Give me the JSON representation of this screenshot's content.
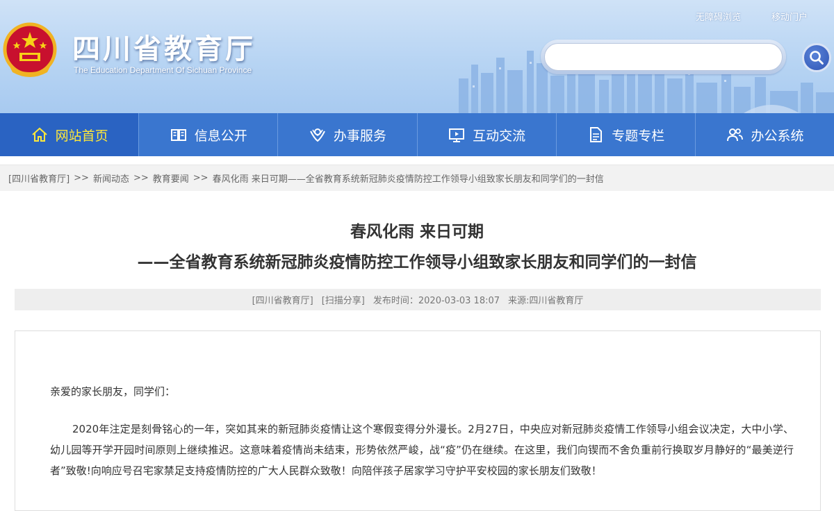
{
  "header": {
    "title": "四川省教育厅",
    "subtitle": "The Education Department Of Sichuan Province",
    "top_links": [
      "无障碍浏览",
      "移动门户"
    ],
    "search": {
      "value": "",
      "placeholder": ""
    }
  },
  "nav": {
    "items": [
      {
        "label": "网站首页",
        "icon": "home-icon",
        "active": true
      },
      {
        "label": "信息公开",
        "icon": "book-icon",
        "active": false
      },
      {
        "label": "办事服务",
        "icon": "service-icon",
        "active": false
      },
      {
        "label": "互动交流",
        "icon": "monitor-icon",
        "active": false
      },
      {
        "label": "专题专栏",
        "icon": "document-icon",
        "active": false
      },
      {
        "label": "办公系统",
        "icon": "users-icon",
        "active": false
      }
    ]
  },
  "breadcrumb": {
    "home": "[四川省教育厅]",
    "sep": ">>",
    "level1": "新闻动态",
    "level2": "教育要闻",
    "current": "春风化雨 来日可期——全省教育系统新冠肺炎疫情防控工作领导小组致家长朋友和同学们的一封信"
  },
  "article": {
    "title_line1": "春风化雨 来日可期",
    "title_line2": "——全省教育系统新冠肺炎疫情防控工作领导小组致家长朋友和同学们的一封信",
    "meta": {
      "site": "[四川省教育厅]",
      "share": "[扫描分享]",
      "date": "发布时间：2020-03-03 18:07",
      "source": "来源:四川省教育厅"
    },
    "greeting": "亲爱的家长朋友，同学们：",
    "paragraph1": "2020年注定是刻骨铭心的一年，突如其来的新冠肺炎疫情让这个寒假变得分外漫长。2月27日，中央应对新冠肺炎疫情工作领导小组会议决定，大中小学、幼儿园等开学开园时间原则上继续推迟。这意味着疫情尚未结束，形势依然严峻，战“疫”仍在继续。在这里，我们向锲而不舍负重前行换取岁月静好的“最美逆行者”致敬!向响应号召宅家禁足支持疫情防控的广大人民群众致敬！向陪伴孩子居家学习守护平安校园的家长朋友们致敬！"
  },
  "colors": {
    "nav_bg": "#3a76cf",
    "nav_active_bg": "#2a63c2",
    "nav_active_text": "#ffe83a",
    "header_sky": "#b7d4f3"
  }
}
